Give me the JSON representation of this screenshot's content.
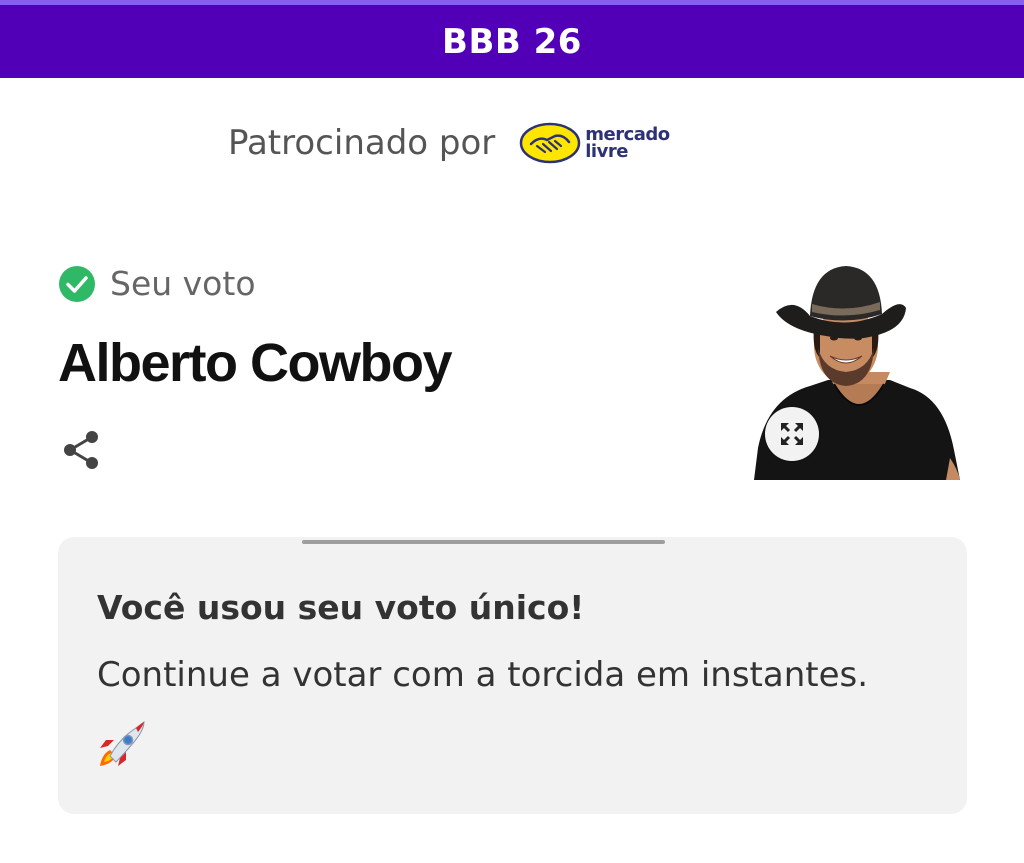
{
  "header": {
    "title": "BBB 26",
    "background_color": "#5200b8"
  },
  "sponsor": {
    "label": "Patrocinado por",
    "logo_line1": "mercado",
    "logo_line2": "livre",
    "logo_icon": "handshake-icon",
    "logo_color": "#ffe600"
  },
  "vote": {
    "status_icon": "check-circle-icon",
    "status_color": "#2fb865",
    "status_label": "Seu voto",
    "candidate_name": "Alberto Cowboy",
    "share_icon": "share-icon",
    "expand_icon": "expand-icon"
  },
  "notice": {
    "title": "Você usou seu voto único!",
    "text": "Continue a votar com a torcida em instantes.",
    "emoji_icon": "rocket-icon"
  }
}
